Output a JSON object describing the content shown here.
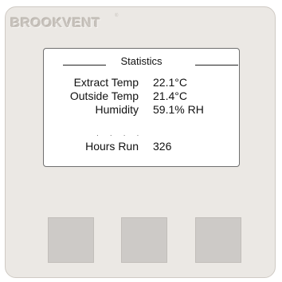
{
  "brand": {
    "name": "BROOKVENT",
    "mark": "®"
  },
  "screen": {
    "title": "Statistics",
    "rows": [
      {
        "label": "Extract Temp",
        "value": "22.1°C"
      },
      {
        "label": "Outside Temp",
        "value": "21.4°C"
      },
      {
        "label": "Humidity",
        "value": "59.1% RH"
      },
      {
        "label": "Hours Run",
        "value": "326"
      }
    ]
  },
  "buttons": [
    {
      "label": ""
    },
    {
      "label": ""
    },
    {
      "label": ""
    }
  ],
  "colors": {
    "panel": "#ebe8e4",
    "screen_bg": "#ffffff",
    "button": "#cdcac7"
  }
}
